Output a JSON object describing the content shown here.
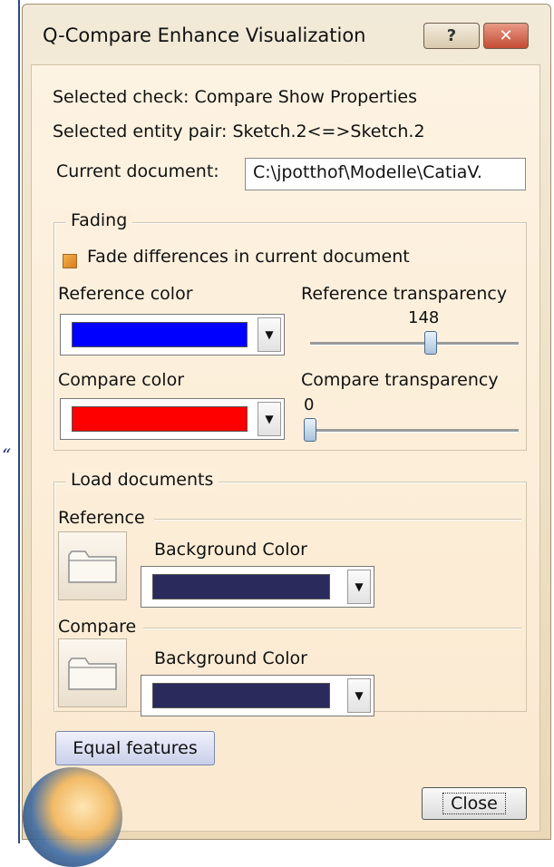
{
  "window": {
    "title": "Q-Compare Enhance Visualization",
    "help_label": "?",
    "close_label": "✕"
  },
  "info": {
    "selected_check": "Selected check: Compare Show Properties",
    "selected_pair": "Selected entity pair: Sketch.2<=>Sketch.2",
    "current_document_label": "Current document:",
    "current_document_value": "C:\\jpotthof\\Modelle\\CatiaV."
  },
  "fading": {
    "title": "Fading",
    "fade_checkbox_label": "Fade differences in current document",
    "fade_checked": true,
    "reference_color_label": "Reference color",
    "reference_color": "#0000ff",
    "reference_transparency_label": "Reference transparency",
    "reference_transparency_value": "148",
    "reference_transparency_fraction": 0.58,
    "compare_color_label": "Compare color",
    "compare_color": "#ff0000",
    "compare_transparency_label": "Compare transparency",
    "compare_transparency_value": "0",
    "compare_transparency_fraction": 0.0
  },
  "load_documents": {
    "title": "Load documents",
    "reference_label": "Reference",
    "reference_bg_label": "Background Color",
    "reference_bg_color": "#2a2a5c",
    "compare_label": "Compare",
    "compare_bg_label": "Background Color",
    "compare_bg_color": "#2a2a5c"
  },
  "buttons": {
    "equal_features": "Equal features",
    "close": "Close"
  },
  "side_quote": "“"
}
